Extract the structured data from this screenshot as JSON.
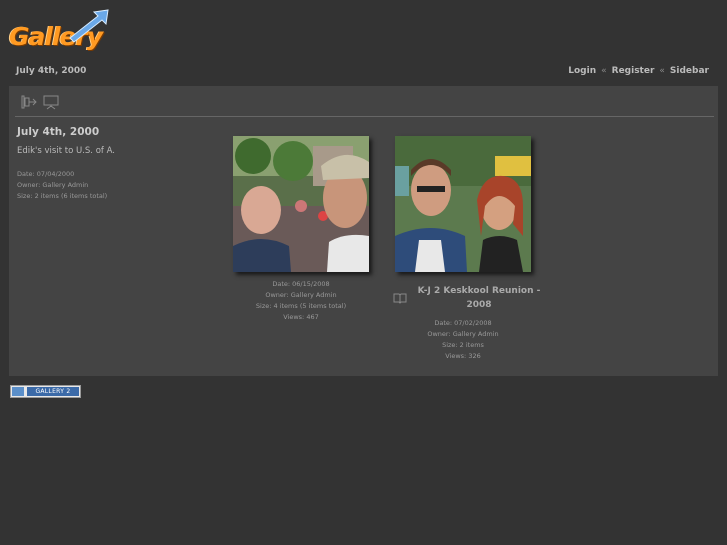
{
  "logo": {
    "text": "Gallery"
  },
  "breadcrumb": {
    "current": "July 4th, 2000"
  },
  "system_links": {
    "login": "Login",
    "register": "Register",
    "sidebar": "Sidebar",
    "separator": "«"
  },
  "toolbar": {
    "icons": [
      "exit-icon",
      "slideshow-icon"
    ]
  },
  "album": {
    "title": "July 4th, 2000",
    "description": "Edik's visit to U.S. of A.",
    "date": "Date: 07/04/2000",
    "owner": "Owner: Gallery Admin",
    "size": "Size: 2 items (6 items total)"
  },
  "items": [
    {
      "title": "",
      "date": "Date: 06/15/2008",
      "owner": "Owner: Gallery Admin",
      "size": "Size: 4 items (5 items total)",
      "views": "Views: 467"
    },
    {
      "title_line1": "K-J 2 Keskkool Reunion -",
      "title_line2": "2008",
      "date": "Date: 07/02/2008",
      "owner": "Owner: Gallery Admin",
      "size": "Size: 2 items",
      "views": "Views: 326",
      "icon": "album-book-icon"
    }
  ],
  "footer": {
    "badge_text": "GALLERY 2"
  }
}
